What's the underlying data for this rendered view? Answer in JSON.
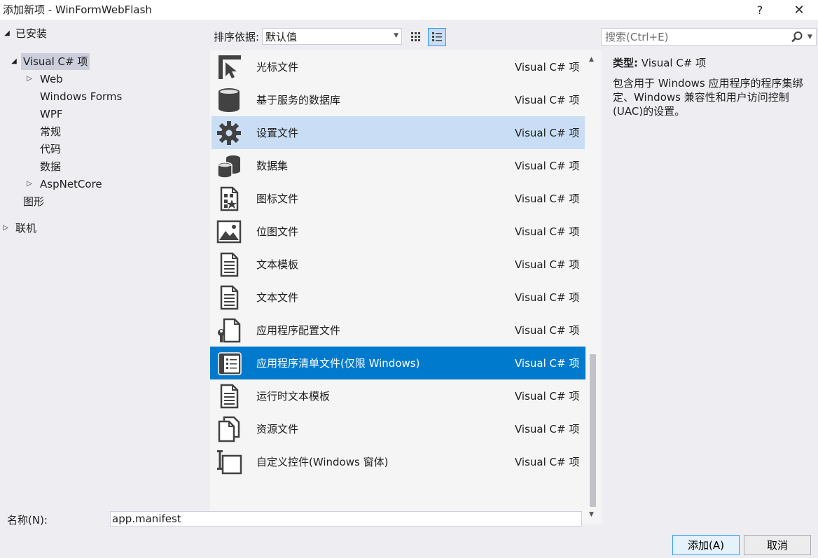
{
  "window": {
    "title": "添加新项 - WinFormWebFlash",
    "help_label": "?",
    "close_label": "✕"
  },
  "tree": {
    "installed": "已安装",
    "visual_cs": "Visual C# 项",
    "web": "Web",
    "windows_forms": "Windows Forms",
    "wpf": "WPF",
    "common": "常规",
    "code": "代码",
    "data": "数据",
    "aspnetcore": "AspNetCore",
    "graphics": "图形",
    "online": "联机"
  },
  "toolbar": {
    "sort_label": "排序依据:",
    "sort_value": "默认值",
    "search_placeholder": "搜索(Ctrl+E)"
  },
  "items": [
    {
      "name": "光标文件",
      "type": "Visual C# 项",
      "icon": "cursor-icon"
    },
    {
      "name": "基于服务的数据库",
      "type": "Visual C# 项",
      "icon": "database-icon"
    },
    {
      "name": "设置文件",
      "type": "Visual C# 项",
      "icon": "gear-icon"
    },
    {
      "name": "数据集",
      "type": "Visual C# 项",
      "icon": "dataset-icon"
    },
    {
      "name": "图标文件",
      "type": "Visual C# 项",
      "icon": "icon-file-icon"
    },
    {
      "name": "位图文件",
      "type": "Visual C# 项",
      "icon": "bitmap-icon"
    },
    {
      "name": "文本模板",
      "type": "Visual C# 项",
      "icon": "text-template-icon"
    },
    {
      "name": "文本文件",
      "type": "Visual C# 项",
      "icon": "text-file-icon"
    },
    {
      "name": "应用程序配置文件",
      "type": "Visual C# 项",
      "icon": "config-file-icon"
    },
    {
      "name": "应用程序清单文件(仅限 Windows)",
      "type": "Visual C# 项",
      "icon": "manifest-icon"
    },
    {
      "name": "运行时文本模板",
      "type": "Visual C# 项",
      "icon": "runtime-template-icon"
    },
    {
      "name": "资源文件",
      "type": "Visual C# 项",
      "icon": "resource-file-icon"
    },
    {
      "name": "自定义控件(Windows 窗体)",
      "type": "Visual C# 项",
      "icon": "custom-control-icon"
    }
  ],
  "description": {
    "type_label": "类型:",
    "type_value": "Visual C# 项",
    "text": "包含用于 Windows 应用程序的程序集绑定、Windows 兼容性和用户访问控制(UAC)的设置。"
  },
  "bottom": {
    "name_label": "名称(N):",
    "name_value": "app.manifest",
    "add_label": "添加(A)",
    "cancel_label": "取消"
  }
}
